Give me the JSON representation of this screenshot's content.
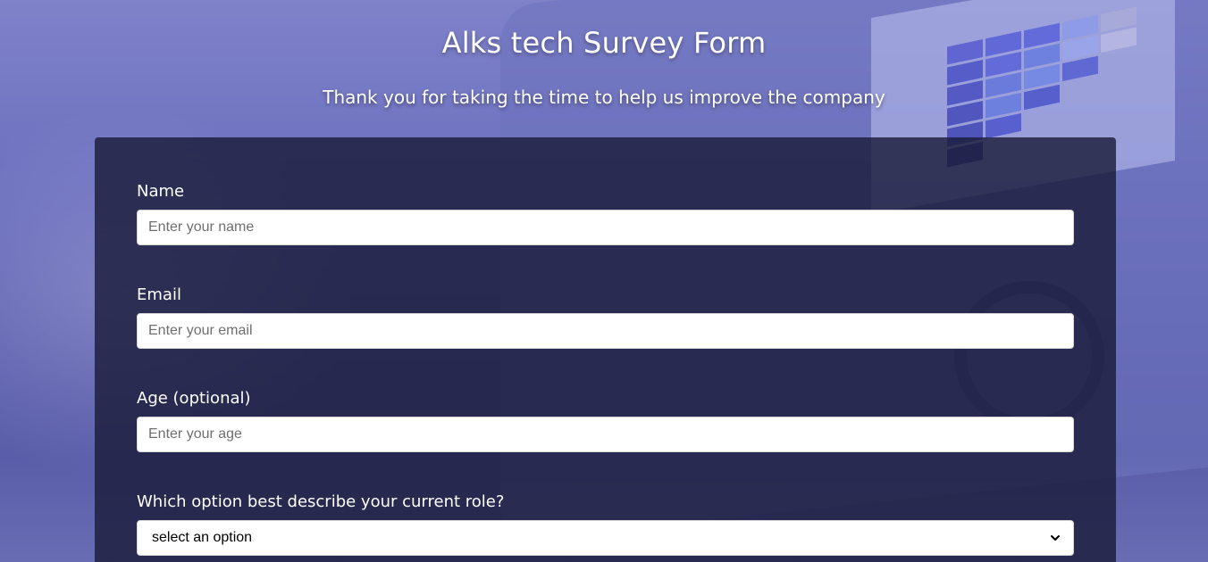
{
  "header": {
    "title": "Alks tech Survey Form",
    "subtitle": "Thank you for taking the time to help us improve the company"
  },
  "form": {
    "name": {
      "label": "Name",
      "placeholder": "Enter your name",
      "value": ""
    },
    "email": {
      "label": "Email",
      "placeholder": "Enter your email",
      "value": ""
    },
    "age": {
      "label": "Age (optional)",
      "placeholder": "Enter your age",
      "value": ""
    },
    "role": {
      "label": "Which option best describe your current role?",
      "selected": "select an option",
      "icon": "chevron-down-icon"
    }
  },
  "colors": {
    "background": "#6b6fbe",
    "card": "#1b1c3a",
    "text": "#ffffff",
    "input_bg": "#ffffff"
  }
}
